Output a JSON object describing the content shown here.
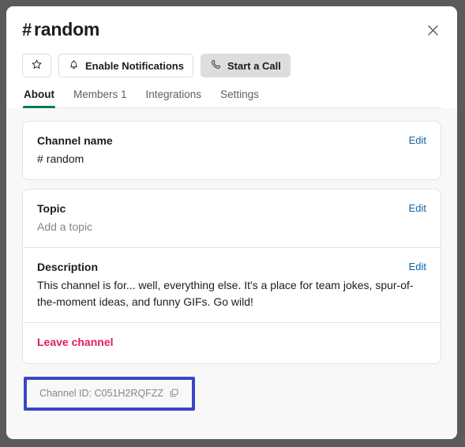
{
  "modal": {
    "title_hash": "#",
    "title": "random",
    "close_label": "Close"
  },
  "actions": {
    "star_icon": "star-outline-icon",
    "notifications_label": "Enable Notifications",
    "notifications_icon": "bell-icon",
    "call_label": "Start a Call",
    "call_icon": "phone-icon"
  },
  "tabs": [
    {
      "label": "About",
      "active": true
    },
    {
      "label": "Members 1",
      "active": false
    },
    {
      "label": "Integrations",
      "active": false
    },
    {
      "label": "Settings",
      "active": false
    }
  ],
  "sections": {
    "channel_name": {
      "label": "Channel name",
      "hash": "#",
      "value": "random",
      "edit_label": "Edit"
    },
    "topic": {
      "label": "Topic",
      "placeholder": "Add a topic",
      "edit_label": "Edit"
    },
    "description": {
      "label": "Description",
      "value": "This channel is for... well, everything else. It's a place for team jokes, spur-of-the-moment ideas, and funny GIFs. Go wild!",
      "edit_label": "Edit"
    },
    "leave": {
      "label": "Leave channel"
    }
  },
  "channel_id": {
    "text": "Channel ID: C051H2RQFZZ",
    "copy_icon": "copy-icon",
    "highlight_color": "#3b46c4"
  },
  "colors": {
    "accent_green": "#007a5a",
    "link_blue": "#1264a3",
    "danger_pink": "#e01e5a",
    "highlight_blue": "#3b46c4"
  }
}
